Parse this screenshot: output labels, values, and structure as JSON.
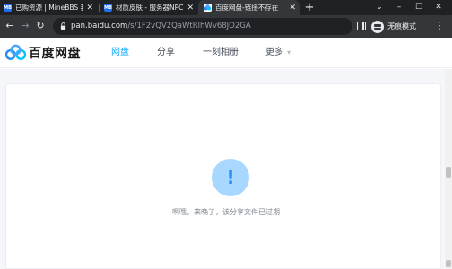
{
  "browser": {
    "tabs": [
      {
        "favicon": "MB",
        "favicon_color": "#1f6feb",
        "title": "已购资源 | MineBBS 我"
      },
      {
        "favicon": "MB",
        "favicon_color": "#1f6feb",
        "title": "材质皮肤 - 服务器NPC"
      },
      {
        "favicon": "cloud-icon",
        "favicon_color": "#2a8bf5",
        "title": "百度网盘-链接不存在"
      }
    ],
    "new_tab": "+",
    "window_controls": {
      "minimize": "–",
      "maximize": "☐",
      "close": "✕"
    },
    "nav": {
      "back": "←",
      "forward": "→",
      "reload": "↻"
    },
    "url": {
      "host": "pan.baidu.com",
      "path": "/s/1F2vQV2QaWtRlhWv68JO2GA"
    },
    "incognito_label": "无痕模式",
    "menu": "⋮",
    "star": "☆"
  },
  "site": {
    "logo_text": "百度网盘",
    "nav": [
      {
        "label": "网盘",
        "active": true
      },
      {
        "label": "分享",
        "active": false
      },
      {
        "label": "一刻相册",
        "active": false
      },
      {
        "label": "更多",
        "active": false
      }
    ],
    "more_caret": "▾"
  },
  "error": {
    "icon": "!",
    "message": "啊哦，来晚了，该分享文件已过期"
  },
  "colors": {
    "accent": "#06a7ff",
    "error_circle": "#a8d8ff",
    "error_mark": "#2f8ff0"
  }
}
